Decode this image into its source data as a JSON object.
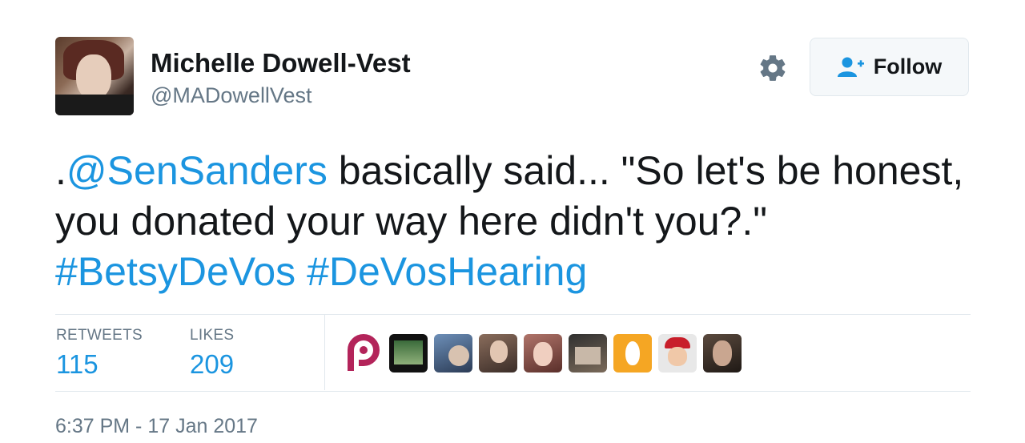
{
  "user": {
    "name": "Michelle Dowell-Vest",
    "handle": "@MADowellVest"
  },
  "follow_button": {
    "label": "Follow"
  },
  "tweet": {
    "prefix": ".",
    "mention": "@SenSanders",
    "body": " basically said... \"So let's be honest, you donated your way here didn't you?.\" ",
    "hashtag1": "#BetsyDeVos",
    "hashtag2": "#DeVosHearing"
  },
  "stats": {
    "retweets_label": "RETWEETS",
    "retweets_value": "115",
    "likes_label": "LIKES",
    "likes_value": "209"
  },
  "timestamp": "6:37 PM - 17 Jan 2017",
  "colors": {
    "link": "#1b95e0",
    "secondary_text": "#657786",
    "primary_text": "#14171a"
  },
  "likers": [
    {
      "icon": "p-logo-icon"
    },
    {
      "icon": "liker-avatar"
    },
    {
      "icon": "liker-avatar"
    },
    {
      "icon": "liker-avatar"
    },
    {
      "icon": "liker-avatar"
    },
    {
      "icon": "liker-avatar"
    },
    {
      "icon": "egg-avatar-icon"
    },
    {
      "icon": "liker-avatar"
    },
    {
      "icon": "liker-avatar"
    }
  ]
}
